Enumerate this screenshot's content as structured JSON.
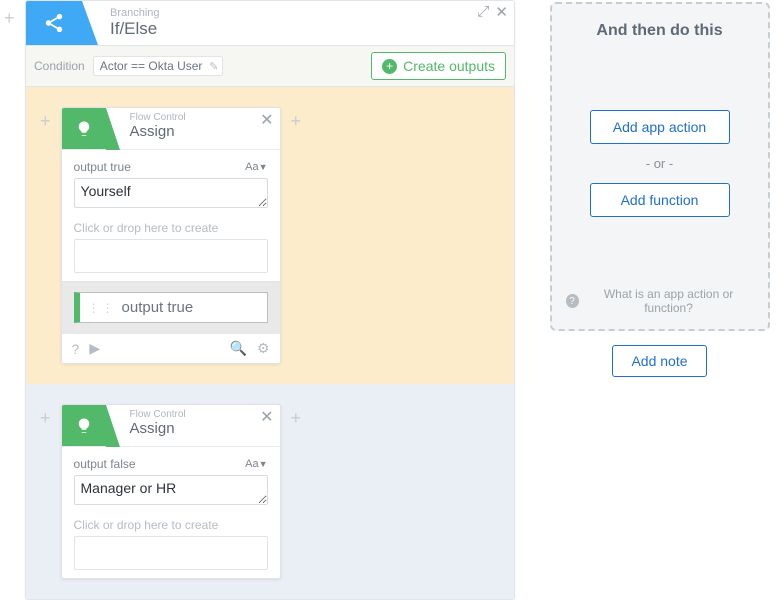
{
  "ifelse": {
    "category": "Branching",
    "title": "If/Else",
    "condition_label": "Condition",
    "condition_text": "Actor == Okta User",
    "create_outputs_label": "Create outputs"
  },
  "branches": {
    "true": {
      "card": {
        "category": "Flow Control",
        "title": "Assign",
        "field_label": "output true",
        "type_selector": "Aa",
        "value": "Yourself",
        "drop_label": "Click or drop here to create",
        "output_pill": "output true"
      }
    },
    "false": {
      "card": {
        "category": "Flow Control",
        "title": "Assign",
        "field_label": "output false",
        "type_selector": "Aa",
        "value": "Manager or HR",
        "drop_label": "Click or drop here to create"
      }
    }
  },
  "right": {
    "title": "And then do this",
    "add_app_action": "Add app action",
    "or": "- or -",
    "add_function": "Add function",
    "help_text": "What is an app action or function?",
    "add_note": "Add note"
  }
}
